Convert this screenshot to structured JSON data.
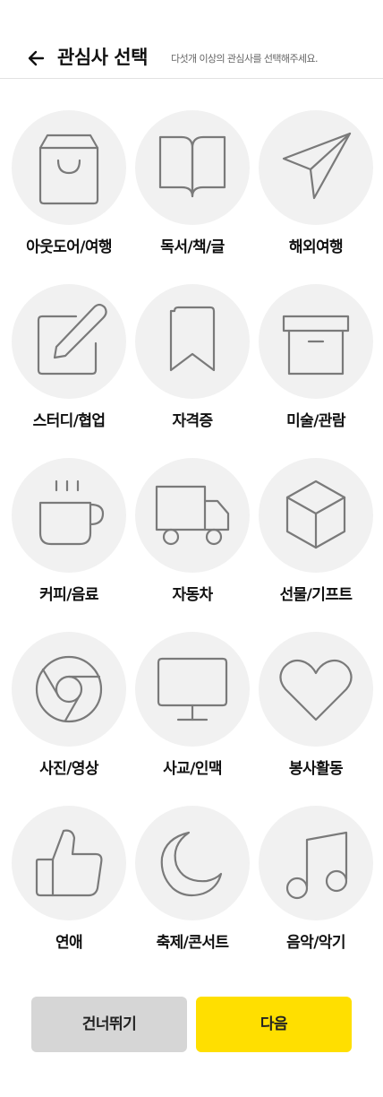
{
  "header": {
    "title": "관심사 선택",
    "subtitle": "다섯개 이상의 관심사를 선택해주세요."
  },
  "interests": [
    {
      "label": "아웃도어/여행",
      "icon": "shopping-bag-icon"
    },
    {
      "label": "독서/책/글",
      "icon": "open-book-icon"
    },
    {
      "label": "해외여행",
      "icon": "paper-plane-icon"
    },
    {
      "label": "스터디/협업",
      "icon": "edit-icon"
    },
    {
      "label": "자격증",
      "icon": "bookmark-icon"
    },
    {
      "label": "미술/관람",
      "icon": "archive-box-icon"
    },
    {
      "label": "커피/음료",
      "icon": "coffee-cup-icon"
    },
    {
      "label": "자동차",
      "icon": "truck-icon"
    },
    {
      "label": "선물/기프트",
      "icon": "cube-icon"
    },
    {
      "label": "사진/영상",
      "icon": "chrome-icon"
    },
    {
      "label": "사교/인맥",
      "icon": "monitor-icon"
    },
    {
      "label": "봉사활동",
      "icon": "heart-icon"
    },
    {
      "label": "연애",
      "icon": "thumbs-up-icon"
    },
    {
      "label": "축제/콘서트",
      "icon": "moon-icon"
    },
    {
      "label": "음악/악기",
      "icon": "music-note-icon"
    }
  ],
  "buttons": {
    "skip": "건너뛰기",
    "next": "다음"
  },
  "colors": {
    "accent": "#ffdf00",
    "secondary_button": "#d6d6d6",
    "tile_background": "#f1f1f1",
    "icon_stroke": "#7a7a7a"
  }
}
